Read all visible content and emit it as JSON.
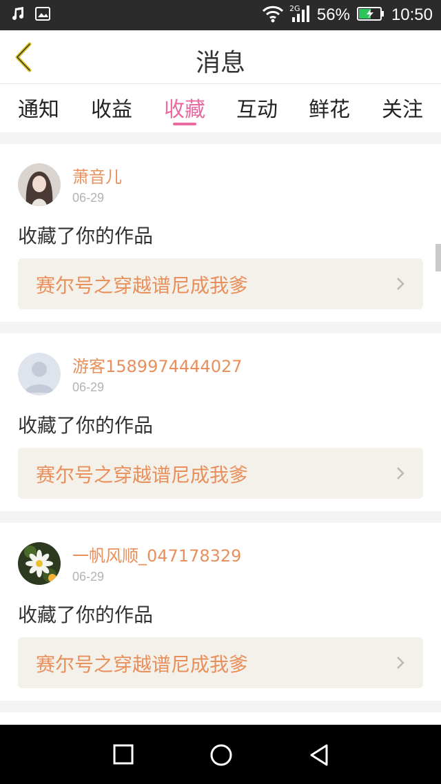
{
  "status_bar": {
    "network": "2G",
    "battery": "56%",
    "time": "10:50"
  },
  "header": {
    "title": "消息"
  },
  "tabs": [
    {
      "label": "通知",
      "active": false
    },
    {
      "label": "收益",
      "active": false
    },
    {
      "label": "收藏",
      "active": true
    },
    {
      "label": "互动",
      "active": false
    },
    {
      "label": "鲜花",
      "active": false
    },
    {
      "label": "关注",
      "active": false
    }
  ],
  "messages": [
    {
      "user": "萧音儿",
      "date": "06-29",
      "action": "收藏了你的作品",
      "work": "赛尔号之穿越谱尼成我爹"
    },
    {
      "user": "游客1589974444027",
      "date": "06-29",
      "action": "收藏了你的作品",
      "work": "赛尔号之穿越谱尼成我爹"
    },
    {
      "user": "一帆风顺_047178329",
      "date": "06-29",
      "action": "收藏了你的作品",
      "work": "赛尔号之穿越谱尼成我爹"
    }
  ],
  "colors": {
    "accent_pink": "#e96aa0",
    "name_orange": "#e98f5b",
    "work_bg": "#f4f1ea"
  }
}
